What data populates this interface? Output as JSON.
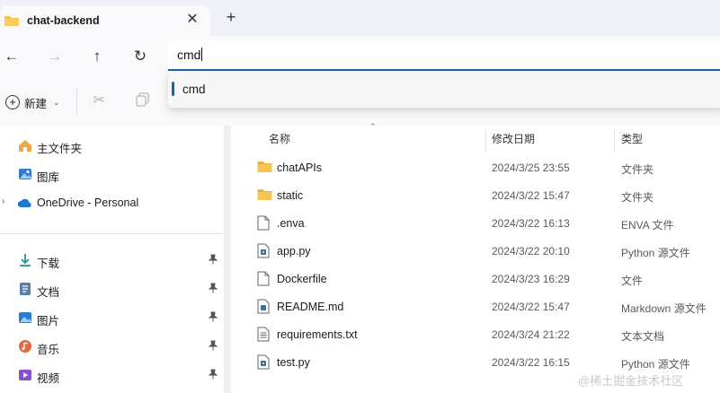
{
  "tab": {
    "title": "chat-backend",
    "close_glyph": "✕",
    "new_tab_glyph": "+"
  },
  "nav": {
    "back_icon": "←",
    "forward_icon": "→",
    "up_icon": "↑",
    "refresh_icon": "↻",
    "address_value": "cmd"
  },
  "autocomplete": {
    "suggestion": "cmd"
  },
  "toolbar": {
    "new_label": "新建",
    "new_chevron": "⌄",
    "cut_icon": "✂"
  },
  "sidebar": {
    "items": [
      {
        "label": "主文件夹",
        "icon": "home-icon"
      },
      {
        "label": "图库",
        "icon": "gallery-icon"
      },
      {
        "label": "OneDrive - Personal",
        "icon": "cloud-icon",
        "expand_chevron": "›"
      }
    ],
    "quick_access": [
      {
        "label": "下载",
        "icon": "download-icon",
        "pinned": true
      },
      {
        "label": "文档",
        "icon": "document-icon",
        "pinned": true
      },
      {
        "label": "图片",
        "icon": "picture-icon",
        "pinned": true
      },
      {
        "label": "音乐",
        "icon": "music-icon",
        "pinned": true
      },
      {
        "label": "视频",
        "icon": "video-icon",
        "pinned": true
      }
    ],
    "pin_glyph": "📌"
  },
  "columns": {
    "name": "名称",
    "modified": "修改日期",
    "type": "类型",
    "sort_glyph": "⌃"
  },
  "files": [
    {
      "name": "chatAPIs",
      "modified": "2024/3/25 23:55",
      "type": "文件夹",
      "kind": "folder"
    },
    {
      "name": "static",
      "modified": "2024/3/22 15:47",
      "type": "文件夹",
      "kind": "folder"
    },
    {
      "name": ".enva",
      "modified": "2024/3/22 16:13",
      "type": "ENVA 文件",
      "kind": "file"
    },
    {
      "name": "app.py",
      "modified": "2024/3/22 20:10",
      "type": "Python 源文件",
      "kind": "python"
    },
    {
      "name": "Dockerfile",
      "modified": "2024/3/23 16:29",
      "type": "文件",
      "kind": "file"
    },
    {
      "name": "README.md",
      "modified": "2024/3/22 15:47",
      "type": "Markdown 源文件",
      "kind": "markdown"
    },
    {
      "name": "requirements.txt",
      "modified": "2024/3/24 21:22",
      "type": "文本文档",
      "kind": "text"
    },
    {
      "name": "test.py",
      "modified": "2024/3/22 16:15",
      "type": "Python 源文件",
      "kind": "python"
    }
  ],
  "watermark": "@稀土掘金技术社区",
  "colors": {
    "accent": "#1a63b3",
    "folder": "#f4c04e",
    "onedrive": "#1e78d4"
  }
}
